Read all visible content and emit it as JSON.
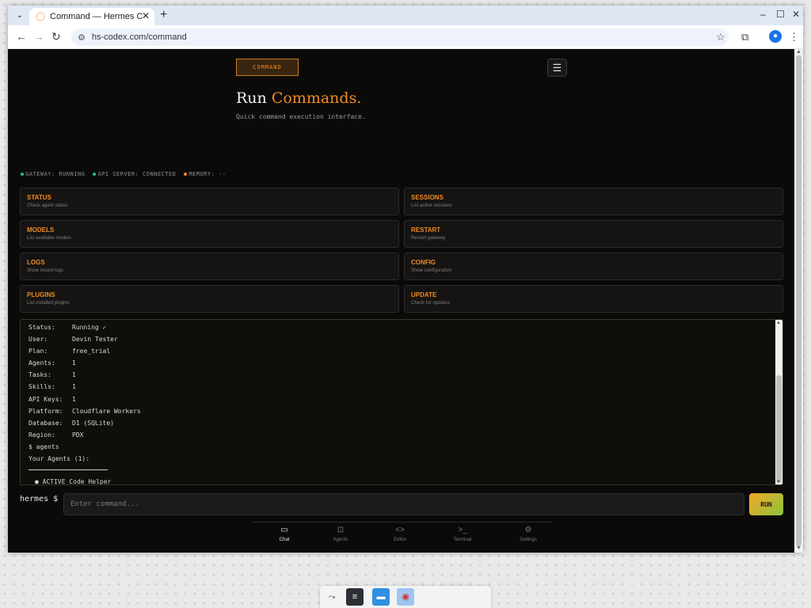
{
  "browser": {
    "tab_title": "Command — Hermes Codex",
    "new_tab": "+",
    "url": "hs-codex.com/command"
  },
  "header": {
    "badge": "COMMAND",
    "menu_icon": "hamburger-icon",
    "headline_plain": "Run ",
    "headline_accent": "Commands.",
    "subtitle": "Quick command execution interface."
  },
  "status": [
    {
      "label": "GATEWAY: RUNNING",
      "color": "#22c08a"
    },
    {
      "label": "API SERVER: CONNECTED",
      "color": "#22c08a"
    },
    {
      "label": "MEMORY: --",
      "color": "#f08a24"
    }
  ],
  "commands": [
    {
      "name": "STATUS",
      "desc": "Check agent status"
    },
    {
      "name": "SESSIONS",
      "desc": "List active sessions"
    },
    {
      "name": "MODELS",
      "desc": "List available models"
    },
    {
      "name": "RESTART",
      "desc": "Restart gateway"
    },
    {
      "name": "LOGS",
      "desc": "Show recent logs"
    },
    {
      "name": "CONFIG",
      "desc": "Show configuration"
    },
    {
      "name": "PLUGINS",
      "desc": "List installed plugins"
    },
    {
      "name": "UPDATE",
      "desc": "Check for updates"
    }
  ],
  "terminal": {
    "rows": [
      {
        "k": "Status:",
        "v": "Running ✓"
      },
      {
        "k": "User:",
        "v": "Devin Tester"
      },
      {
        "k": "Plan:",
        "v": "free_trial"
      },
      {
        "k": "Agents:",
        "v": "1"
      },
      {
        "k": "Tasks:",
        "v": "1"
      },
      {
        "k": "Skills:",
        "v": "1"
      },
      {
        "k": "API Keys:",
        "v": "1"
      },
      {
        "k": "Platform:",
        "v": "Cloudflare Workers"
      },
      {
        "k": "Database:",
        "v": "D1 (SQLite)"
      },
      {
        "k": "Region:",
        "v": "PDX"
      }
    ],
    "cmd_line": "$ agents",
    "agents_header": "Your Agents (1):",
    "agent_line": "● ACTIVE Code Helper"
  },
  "input": {
    "prompt": "hermes $",
    "placeholder": "Enter command...",
    "run_label": "RUN"
  },
  "nav": [
    {
      "label": "Chat",
      "icon": "chat-icon",
      "active": true
    },
    {
      "label": "Agents",
      "icon": "robot-icon",
      "active": false
    },
    {
      "label": "Editor",
      "icon": "code-icon",
      "active": false
    },
    {
      "label": "Terminal",
      "icon": "terminal-icon",
      "active": false
    },
    {
      "label": "Settings",
      "icon": "gear-icon",
      "active": false
    }
  ]
}
